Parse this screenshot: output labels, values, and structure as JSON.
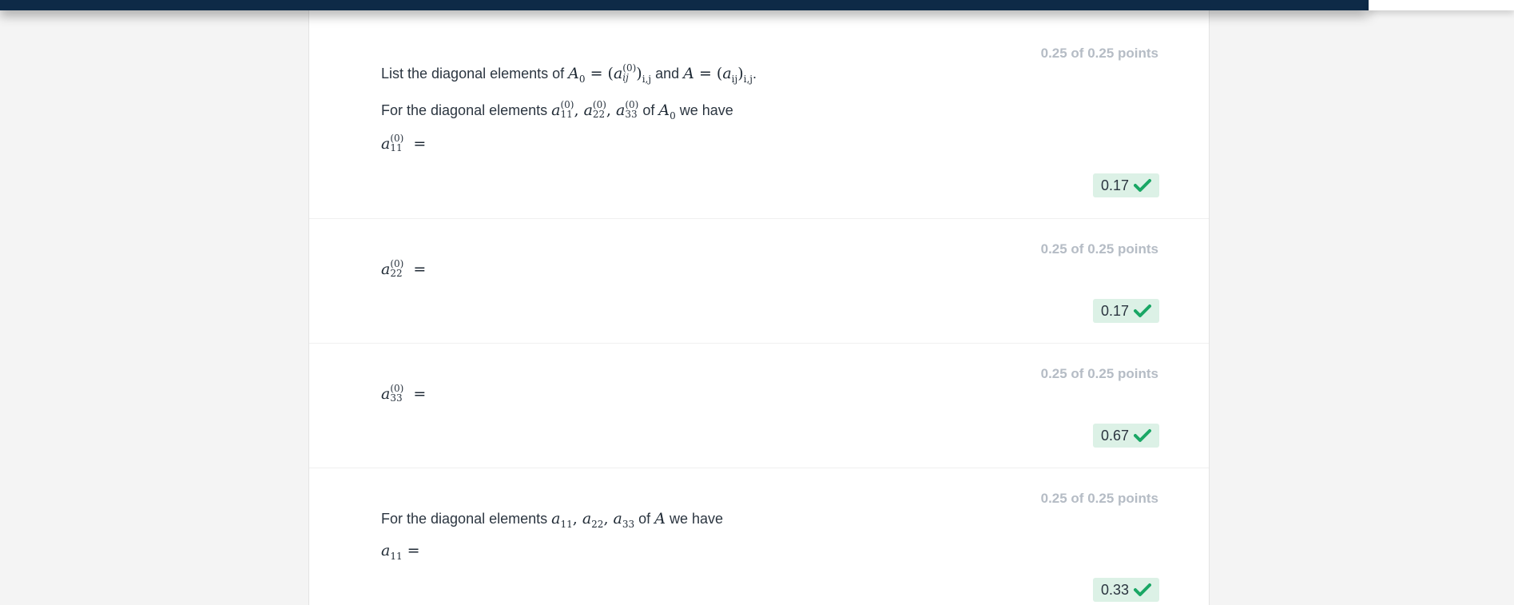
{
  "header": {
    "bar_color": "#0e2a47"
  },
  "questions": [
    {
      "points": "0.25 of 0.25 points",
      "intro_text": "List the diagonal elements of",
      "intro_and": "and",
      "intro_end": ".",
      "prompt_text": "For the diagonal elements",
      "prompt_of": "of",
      "prompt_we_have": "we have",
      "score": "0.17",
      "status_icon": "check-icon"
    },
    {
      "points": "0.25 of 0.25 points",
      "score": "0.17",
      "status_icon": "check-icon"
    },
    {
      "points": "0.25 of 0.25 points",
      "score": "0.67",
      "status_icon": "check-icon"
    },
    {
      "points": "0.25 of 0.25 points",
      "prompt_text": "For the diagonal elements",
      "prompt_of": "of",
      "prompt_we_have": "we have",
      "score": "0.33",
      "status_icon": "check-icon"
    }
  ],
  "colors": {
    "correct_badge_bg": "#dcf1e6",
    "check_color": "#1aa765",
    "points_color": "#b5bcc5"
  }
}
